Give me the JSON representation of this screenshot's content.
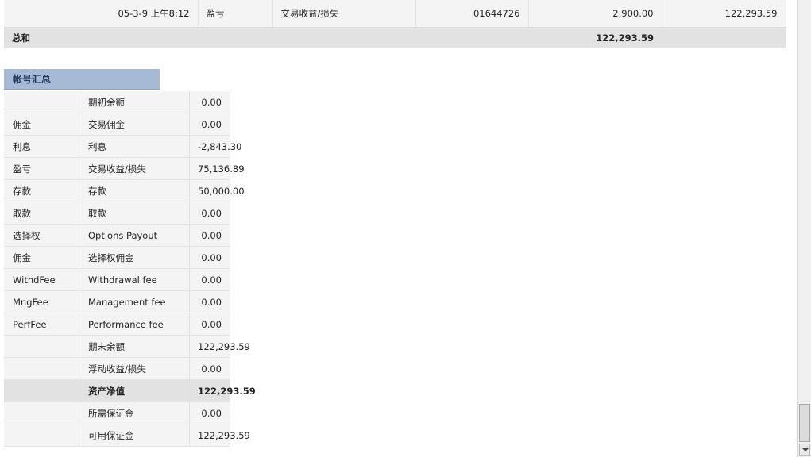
{
  "transactions": {
    "last_row": {
      "datetime": "05-3-9 上午8:12",
      "category": "盈亏",
      "description": "交易收益/损失",
      "ticket": "01644726",
      "amount": "2,900.00",
      "balance": "122,293.59"
    },
    "total": {
      "label": "总和",
      "amount": "122,293.59"
    }
  },
  "summary": {
    "title": "帐号汇总",
    "rows": [
      {
        "type": "",
        "name": "期初余额",
        "value": "0.00"
      },
      {
        "type": "佣金",
        "name": "交易佣金",
        "value": "0.00"
      },
      {
        "type": "利息",
        "name": "利息",
        "value": "-2,843.30"
      },
      {
        "type": "盈亏",
        "name": "交易收益/损失",
        "value": "75,136.89"
      },
      {
        "type": "存款",
        "name": "存款",
        "value": "50,000.00"
      },
      {
        "type": "取款",
        "name": "取款",
        "value": "0.00"
      },
      {
        "type": "选择权",
        "name": "Options Payout",
        "value": "0.00"
      },
      {
        "type": "佣金",
        "name": "选择权佣金",
        "value": "0.00"
      },
      {
        "type": "WithdFee",
        "name": "Withdrawal fee",
        "value": "0.00"
      },
      {
        "type": "MngFee",
        "name": "Management fee",
        "value": "0.00"
      },
      {
        "type": "PerfFee",
        "name": "Performance fee",
        "value": "0.00"
      },
      {
        "type": "",
        "name": "期末余额",
        "value": "122,293.59"
      },
      {
        "type": "",
        "name": "浮动收益/损失",
        "value": "0.00"
      },
      {
        "type": "",
        "name": "资产净值",
        "value": "122,293.59"
      },
      {
        "type": "",
        "name": "所需保证金",
        "value": "0.00"
      },
      {
        "type": "",
        "name": "可用保证金",
        "value": "122,293.59"
      }
    ]
  },
  "scrollbar": {
    "position_fraction": 1.0
  }
}
